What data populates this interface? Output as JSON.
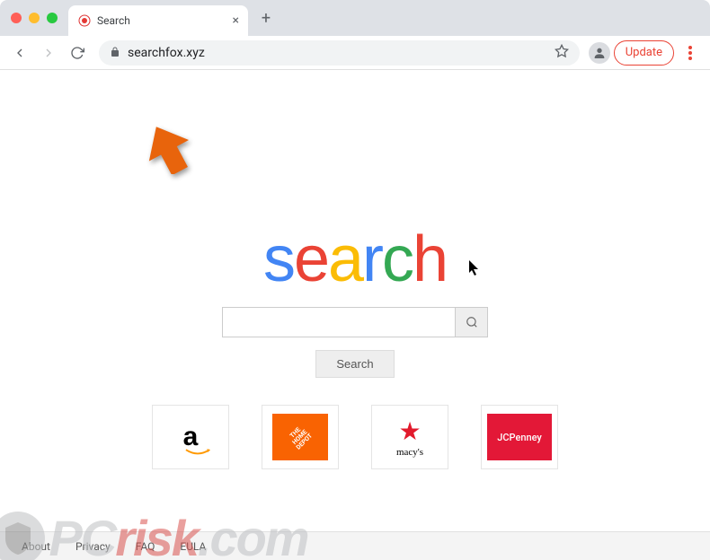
{
  "browser": {
    "tab": {
      "title": "Search",
      "favicon_color_outer": "#ffffff",
      "favicon_color_inner": "#e53935"
    },
    "url": "searchfox.xyz",
    "update_label": "Update"
  },
  "page": {
    "logo_letters": [
      "s",
      "e",
      "a",
      "r",
      "c",
      "h"
    ],
    "search_placeholder": "",
    "search_button_label": "Search",
    "tiles": [
      {
        "name": "Amazon",
        "key": "amazon"
      },
      {
        "name": "The Home Depot",
        "key": "homedepot"
      },
      {
        "name": "Macy's",
        "key": "macys",
        "label": "macy's"
      },
      {
        "name": "JCPenney",
        "key": "jcpenney",
        "label": "JCPenney"
      }
    ],
    "footer_links": [
      "About",
      "Privacy",
      "FAQ",
      "EULA"
    ]
  },
  "watermark": {
    "text_pc": "PC",
    "text_risk": "risk",
    "text_com": ".com"
  }
}
